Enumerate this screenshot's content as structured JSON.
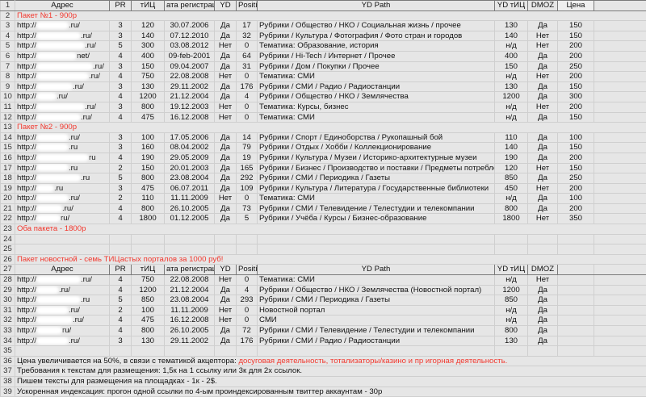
{
  "headers": [
    "Адрес",
    "PR",
    "тИЦ",
    "ата регистраци",
    "YD",
    "Positi",
    "YD Path",
    "YD тИЦ",
    "DMOZ",
    "Цена"
  ],
  "rows": [
    {
      "n": "1",
      "type": "header",
      "price": true
    },
    {
      "n": "2",
      "type": "section",
      "text": "Пакет №1 - 900р"
    },
    {
      "n": "3",
      "type": "data",
      "url": [
        "http://",
        ".ru/"
      ],
      "blob": 40,
      "cells": [
        "3",
        "120",
        "30.07.2006",
        "Да",
        "17",
        "Рубрики / Общество / НКО / Социальная жизнь / прочее",
        "130",
        "Да",
        "150"
      ]
    },
    {
      "n": "4",
      "type": "data",
      "url": [
        "http://",
        ".ru/"
      ],
      "blob": 55,
      "cells": [
        "3",
        "140",
        "07.12.2010",
        "Да",
        "32",
        "Рубрики / Культура / Фотография / Фото стран и городов",
        "140",
        "Нет",
        "150"
      ]
    },
    {
      "n": "5",
      "type": "data",
      "url": [
        "http://",
        ".ru/"
      ],
      "blob": 60,
      "cells": [
        "5",
        "300",
        "03.08.2012",
        "Нет",
        "0",
        "Тематика: Образование, история",
        "н/д",
        "Нет",
        "200"
      ]
    },
    {
      "n": "6",
      "type": "data",
      "url": [
        "http://",
        "net/"
      ],
      "blob": 50,
      "cells": [
        "4",
        "400",
        "09-feb-2001",
        "Да",
        "64",
        "Рубрики / Hi-Tech / Интернет / Прочее",
        "400",
        "Да",
        "200"
      ]
    },
    {
      "n": "7",
      "type": "data",
      "url": [
        "http://",
        ".ru/"
      ],
      "blob": 70,
      "cells": [
        "3",
        "150",
        "09.04.2007",
        "Да",
        "31",
        "Рубрики / Дом / Покупки / Прочее",
        "150",
        "Да",
        "250"
      ]
    },
    {
      "n": "8",
      "type": "data",
      "url": [
        "http://",
        ".ru/"
      ],
      "blob": 65,
      "cells": [
        "4",
        "750",
        "22.08.2008",
        "Нет",
        "0",
        "Тематика: СМИ",
        "н/д",
        "Нет",
        "200"
      ]
    },
    {
      "n": "9",
      "type": "data",
      "url": [
        "http://",
        ".ru/"
      ],
      "blob": 45,
      "cells": [
        "3",
        "130",
        "29.11.2002",
        "Да",
        "176",
        "Рубрики / СМИ / Радио / Радиостанции",
        "130",
        "Да",
        "150"
      ]
    },
    {
      "n": "10",
      "type": "data",
      "url": [
        "http://",
        ".ru/"
      ],
      "blob": 25,
      "cells": [
        "4",
        "1200",
        "21.12.2004",
        "Да",
        "4",
        "Рубрики / Общество / НКО / Землячества",
        "1200",
        "Да",
        "300"
      ]
    },
    {
      "n": "11",
      "type": "data",
      "url": [
        "http://",
        ".ru/"
      ],
      "blob": 60,
      "cells": [
        "3",
        "800",
        "19.12.2003",
        "Нет",
        "0",
        "Тематика: Курсы, бизнес",
        "н/д",
        "Нет",
        "200"
      ]
    },
    {
      "n": "12",
      "type": "data",
      "url": [
        "http://",
        ".ru/"
      ],
      "blob": 55,
      "cells": [
        "4",
        "475",
        "16.12.2008",
        "Нет",
        "0",
        "Тематика: СМИ",
        "н/д",
        "Да",
        "150"
      ]
    },
    {
      "n": "13",
      "type": "section",
      "text": "Пакет №2 - 900р"
    },
    {
      "n": "14",
      "type": "data",
      "url": [
        "http://",
        ".ru/"
      ],
      "blob": 40,
      "cells": [
        "3",
        "100",
        "17.05.2006",
        "Да",
        "14",
        "Рубрики / Спорт / Единоборства / Рукопашный бой",
        "110",
        "Да",
        "100"
      ]
    },
    {
      "n": "15",
      "type": "data",
      "url": [
        "http://",
        ".ru"
      ],
      "blob": 40,
      "cells": [
        "3",
        "160",
        "08.04.2002",
        "Да",
        "79",
        "Рубрики / Отдых / Хобби / Коллекционирование",
        "140",
        "Да",
        "150"
      ]
    },
    {
      "n": "16",
      "type": "data",
      "url": [
        "http://",
        "ru"
      ],
      "blob": 65,
      "cells": [
        "4",
        "190",
        "29.05.2009",
        "Да",
        "19",
        "Рубрики / Культура / Музеи / Историко-архитектурные музеи",
        "190",
        "Да",
        "200"
      ]
    },
    {
      "n": "17",
      "type": "data",
      "url": [
        "http://",
        ".ru"
      ],
      "blob": 40,
      "cells": [
        "2",
        "150",
        "20.01.2003",
        "Да",
        "165",
        "Рубрики / Бизнес / Производство и поставки / Предметы потребления / Издательства",
        "120",
        "Нет",
        "150"
      ]
    },
    {
      "n": "18",
      "type": "data",
      "url": [
        "http://",
        ".ru"
      ],
      "blob": 55,
      "cells": [
        "5",
        "800",
        "23.08.2004",
        "Да",
        "292",
        "Рубрики / СМИ / Периодика / Газеты",
        "850",
        "Да",
        "250"
      ]
    },
    {
      "n": "19",
      "type": "data",
      "url": [
        "http://",
        ".ru"
      ],
      "blob": 22,
      "cells": [
        "3",
        "475",
        "06.07.2011",
        "Да",
        "109",
        "Рубрики / Культура / Литература / Государственные  библиотеки",
        "450",
        "Нет",
        "200"
      ]
    },
    {
      "n": "20",
      "type": "data",
      "url": [
        "http://",
        ".ru/"
      ],
      "blob": 40,
      "cells": [
        "2",
        "110",
        "11.11.2009",
        "Нет",
        "0",
        "Тематика: СМИ",
        "н/д",
        "Да",
        "100"
      ]
    },
    {
      "n": "21",
      "type": "data",
      "url": [
        "http://",
        ".ru/"
      ],
      "blob": 32,
      "cells": [
        "4",
        "800",
        "26.10.2005",
        "Да",
        "73",
        "Рубрики / СМИ / Телевидение / Телестудии и телекомпании",
        "800",
        "Да",
        "200"
      ]
    },
    {
      "n": "22",
      "type": "data",
      "url": [
        "http://",
        "ru/"
      ],
      "blob": 30,
      "cells": [
        "4",
        "1800",
        "01.12.2005",
        "Да",
        "5",
        "Рубрики / Учёба / Курсы / Бизнес-образование",
        "1800",
        "Нет",
        "350"
      ]
    },
    {
      "n": "23",
      "type": "section",
      "text": "Оба пакета - 1800р"
    },
    {
      "n": "24",
      "type": "blank"
    },
    {
      "n": "25",
      "type": "blank"
    },
    {
      "n": "26",
      "type": "section",
      "text": "Пакет новостной - семь ТИЦастых порталов за 1000 руб!"
    },
    {
      "n": "27",
      "type": "header",
      "price": false
    },
    {
      "n": "28",
      "type": "data",
      "url": [
        "http://",
        ".ru/"
      ],
      "blob": 55,
      "cells": [
        "4",
        "750",
        "22.08.2008",
        "Нет",
        "0",
        "Тематика: СМИ",
        "н/д",
        "Нет",
        ""
      ]
    },
    {
      "n": "29",
      "type": "data",
      "url": [
        "http://",
        ".ru/"
      ],
      "blob": 28,
      "cells": [
        "4",
        "1200",
        "21.12.2004",
        "Да",
        "4",
        "Рубрики / Общество / НКО / Землячества (Новостной портал)",
        "1200",
        "Да",
        ""
      ]
    },
    {
      "n": "30",
      "type": "data",
      "url": [
        "http://",
        ".ru"
      ],
      "blob": 55,
      "cells": [
        "5",
        "850",
        "23.08.2004",
        "Да",
        "293",
        "Рубрики / СМИ / Периодика / Газеты",
        "850",
        "Да",
        ""
      ]
    },
    {
      "n": "31",
      "type": "data",
      "url": [
        "http://",
        ".ru/"
      ],
      "blob": 40,
      "cells": [
        "2",
        "100",
        "11.11.2009",
        "Нет",
        "0",
        "Новостной портал",
        "н/д",
        "Да",
        ""
      ]
    },
    {
      "n": "32",
      "type": "data",
      "url": [
        "http://",
        ".ru/"
      ],
      "blob": 45,
      "cells": [
        "4",
        "475",
        "16.12.2008",
        "Нет",
        "0",
        "СМИ",
        "н/д",
        "Да",
        ""
      ]
    },
    {
      "n": "33",
      "type": "data",
      "url": [
        "http://",
        "ru/"
      ],
      "blob": 32,
      "cells": [
        "4",
        "800",
        "26.10.2005",
        "Да",
        "72",
        "Рубрики / СМИ / Телевидение / Телестудии и телекомпании",
        "800",
        "Да",
        ""
      ]
    },
    {
      "n": "34",
      "type": "data",
      "url": [
        "http://",
        ".ru/"
      ],
      "blob": 40,
      "cells": [
        "3",
        "130",
        "29.11.2002",
        "Да",
        "176",
        "Рубрики / СМИ / Радио / Радиостанции",
        "130",
        "Да",
        ""
      ]
    },
    {
      "n": "35",
      "type": "blank"
    },
    {
      "n": "36",
      "type": "note",
      "text": "Цена увеличивается на 50%, в связи с тематикой акцептора: ",
      "red": "досуговая деятельность, тотализаторы/казино и пр игорная деятельность."
    },
    {
      "n": "37",
      "type": "note",
      "text": "Требования к текстам для размещения: 1,5к на 1 ссылку или 3к для 2х ссылок."
    },
    {
      "n": "38",
      "type": "note",
      "text": "Пишем тексты для размещения на площадках - 1к - 2$."
    },
    {
      "n": "39",
      "type": "note",
      "text": "Ускоренная индексация: прогон одной ссылки по 4-ым проиндексированным твиттер аккаунтам - 30р"
    }
  ]
}
